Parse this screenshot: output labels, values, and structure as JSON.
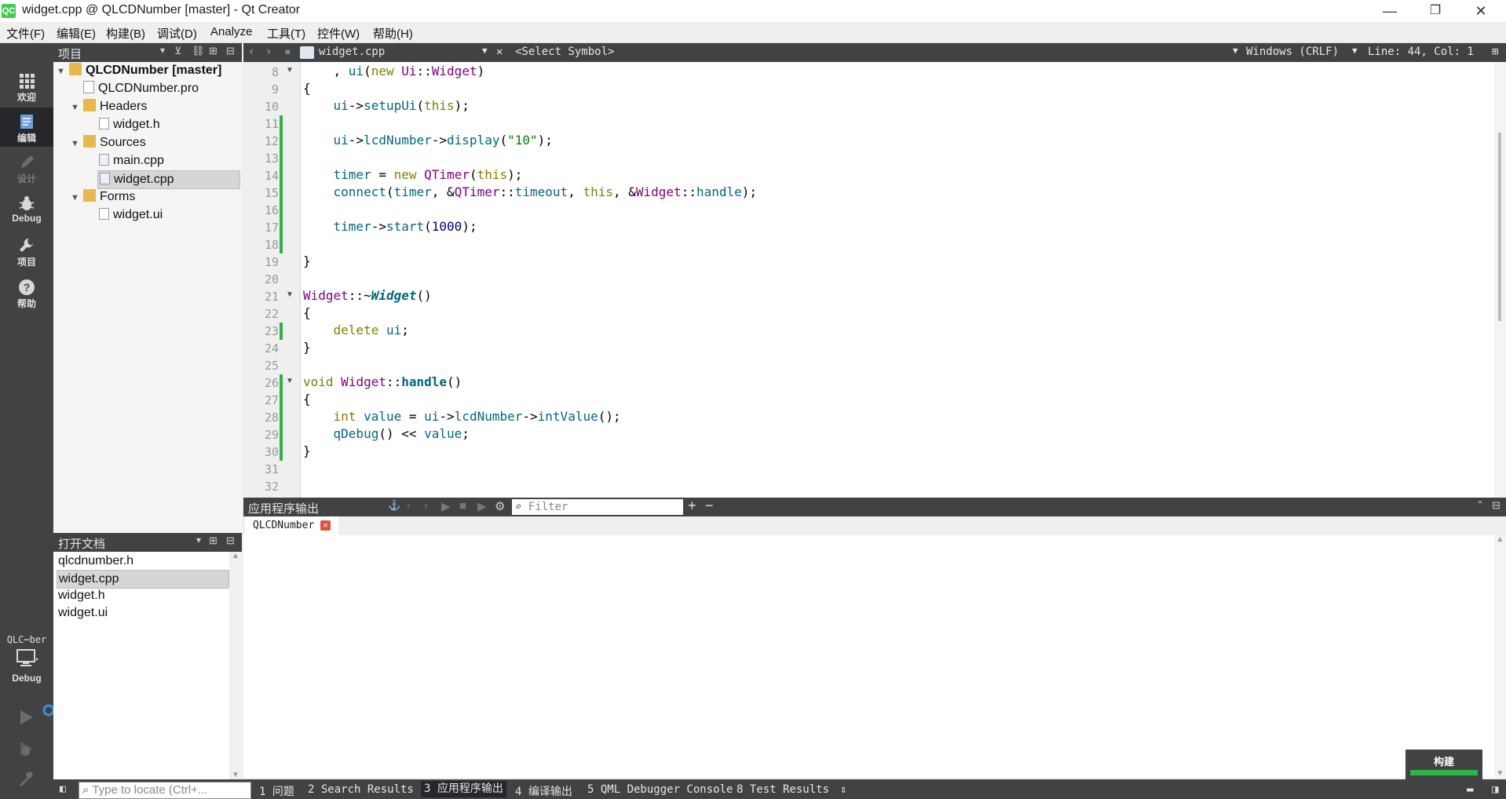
{
  "window": {
    "app_icon": "QC",
    "title": "widget.cpp @ QLCDNumber [master] - Qt Creator",
    "minimize": "—",
    "restore": "❐",
    "close": "✕"
  },
  "menu": [
    "文件(F)",
    "编辑(E)",
    "构建(B)",
    "调试(D)",
    "Analyze",
    "工具(T)",
    "控件(W)",
    "帮助(H)"
  ],
  "modes": [
    {
      "label": "欢迎",
      "icon": "grid-icon"
    },
    {
      "label": "编辑",
      "icon": "edit-icon"
    },
    {
      "label": "设计",
      "icon": "pencil-icon"
    },
    {
      "label": "Debug",
      "icon": "bug-icon"
    },
    {
      "label": "项目",
      "icon": "wrench-icon"
    },
    {
      "label": "帮助",
      "icon": "help-icon"
    }
  ],
  "kit": {
    "name": "QLC⋯ber",
    "mode": "Debug"
  },
  "project_panel": {
    "title": "项目",
    "tree": [
      {
        "label": "QLCDNumber [master]",
        "level": 0,
        "type": "project",
        "expanded": true
      },
      {
        "label": "QLCDNumber.pro",
        "level": 1,
        "type": "pro"
      },
      {
        "label": "Headers",
        "level": 1,
        "type": "folder",
        "expanded": true
      },
      {
        "label": "widget.h",
        "level": 2,
        "type": "header"
      },
      {
        "label": "Sources",
        "level": 1,
        "type": "folder",
        "expanded": true
      },
      {
        "label": "main.cpp",
        "level": 2,
        "type": "cpp"
      },
      {
        "label": "widget.cpp",
        "level": 2,
        "type": "cpp",
        "selected": true
      },
      {
        "label": "Forms",
        "level": 1,
        "type": "folder",
        "expanded": true
      },
      {
        "label": "widget.ui",
        "level": 2,
        "type": "ui"
      }
    ]
  },
  "open_docs": {
    "title": "打开文档",
    "items": [
      "qlcdnumber.h",
      "widget.cpp",
      "widget.h",
      "widget.ui"
    ],
    "selected": 1
  },
  "editor_toolbar": {
    "file": "widget.cpp",
    "symbol": "<Select Symbol>",
    "line_ending": "Windows (CRLF)",
    "position": "Line: 44, Col: 1"
  },
  "editor": {
    "first_line": 8,
    "lines": [
      "    , ui(new Ui::Widget)",
      "{",
      "    ui->setupUi(this);",
      "",
      "    ui->lcdNumber->display(\"10\");",
      "",
      "    timer = new QTimer(this);",
      "    connect(timer, &QTimer::timeout, this, &Widget::handle);",
      "",
      "    timer->start(1000);",
      "",
      "}",
      "",
      "Widget::~Widget()",
      "{",
      "    delete ui;",
      "}",
      "",
      "void Widget::handle()",
      "{",
      "    int value = ui->lcdNumber->intValue();",
      "    qDebug() << value;",
      "}",
      "",
      ""
    ]
  },
  "output_pane": {
    "title": "应用程序输出",
    "filter_placeholder": "Filter",
    "tab": "QLCDNumber"
  },
  "status_bar": {
    "locate_placeholder": "Type to locate (Ctrl+...",
    "tabs": [
      "1 问题",
      "2 Search Results",
      "3 应用程序输出",
      "4 编译输出",
      "5 QML Debugger Console",
      "8 Test Results"
    ]
  },
  "build_badge": "构建",
  "colors": {
    "accent_green": "#2fb344",
    "dark_panel": "#404244"
  }
}
